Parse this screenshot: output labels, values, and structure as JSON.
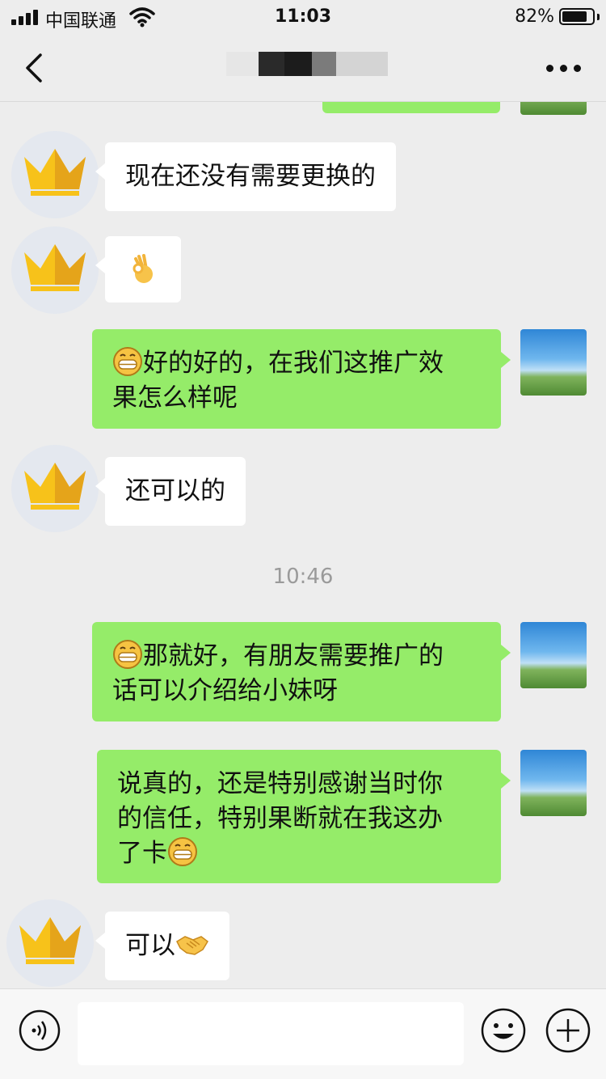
{
  "status_bar": {
    "carrier": "中国联通",
    "time": "11:03",
    "battery_percent": "82%",
    "battery_level": 0.82
  },
  "nav": {
    "contact_name_redacted": ""
  },
  "messages": [
    {
      "side": "left",
      "text": "现在还没有需要更换的"
    },
    {
      "side": "left",
      "emoji": "ok-hand-emoji"
    },
    {
      "side": "right",
      "line1": "好的好的，在我们这推广效",
      "line2": "果怎么样呢",
      "lead_emoji": "grin-emoji"
    },
    {
      "side": "left",
      "text": "还可以的"
    },
    {
      "side": "right",
      "line1": "那就好，有朋友需要推广的",
      "line2": "话可以介绍给小妹呀",
      "lead_emoji": "grin-emoji"
    },
    {
      "side": "right",
      "line1": "说真的，还是特别感谢当时你",
      "line2": "的信任，特别果断就在我这办",
      "line3": "了卡",
      "trail_emoji": "grin-emoji"
    },
    {
      "side": "left",
      "text": "可以",
      "trail_emoji": "handshake-emoji"
    }
  ],
  "timestamp_separator": "10:46",
  "input_bar": {
    "placeholder": "",
    "icons": [
      "voice-icon",
      "emoji-icon",
      "plus-icon"
    ]
  },
  "colors": {
    "background": "#ededed",
    "sent_bubble": "#95ec69",
    "received_bubble": "#ffffff",
    "timestamp_text": "#9a9a9a"
  }
}
